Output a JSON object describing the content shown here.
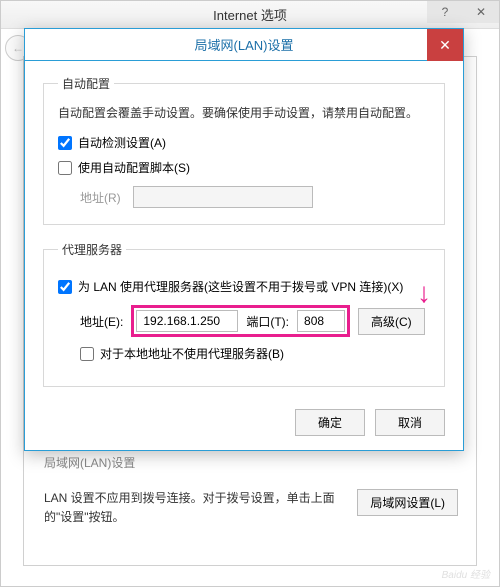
{
  "parent": {
    "title": "Internet 选项",
    "lan_heading": "局域网(LAN)设置",
    "lan_hint": "LAN 设置不应用到拨号连接。对于拨号设置，单击上面的\"设置\"按钮。",
    "lan_button": "局域网设置(L)"
  },
  "dialog": {
    "title": "局域网(LAN)设置",
    "auto_config": {
      "legend": "自动配置",
      "desc": "自动配置会覆盖手动设置。要确保使用手动设置，请禁用自动配置。",
      "auto_detect_label": "自动检测设置(A)",
      "auto_detect_checked": true,
      "use_script_label": "使用自动配置脚本(S)",
      "use_script_checked": false,
      "address_label": "地址(R)",
      "address_value": ""
    },
    "proxy": {
      "legend": "代理服务器",
      "use_proxy_label": "为 LAN 使用代理服务器(这些设置不用于拨号或 VPN 连接)(X)",
      "use_proxy_checked": true,
      "address_label": "地址(E):",
      "address_value": "192.168.1.250",
      "port_label": "端口(T):",
      "port_value": "808",
      "advanced_label": "高级(C)",
      "bypass_local_label": "对于本地地址不使用代理服务器(B)",
      "bypass_local_checked": false
    },
    "ok_label": "确定",
    "cancel_label": "取消"
  },
  "watermark": "Baidu 经验"
}
